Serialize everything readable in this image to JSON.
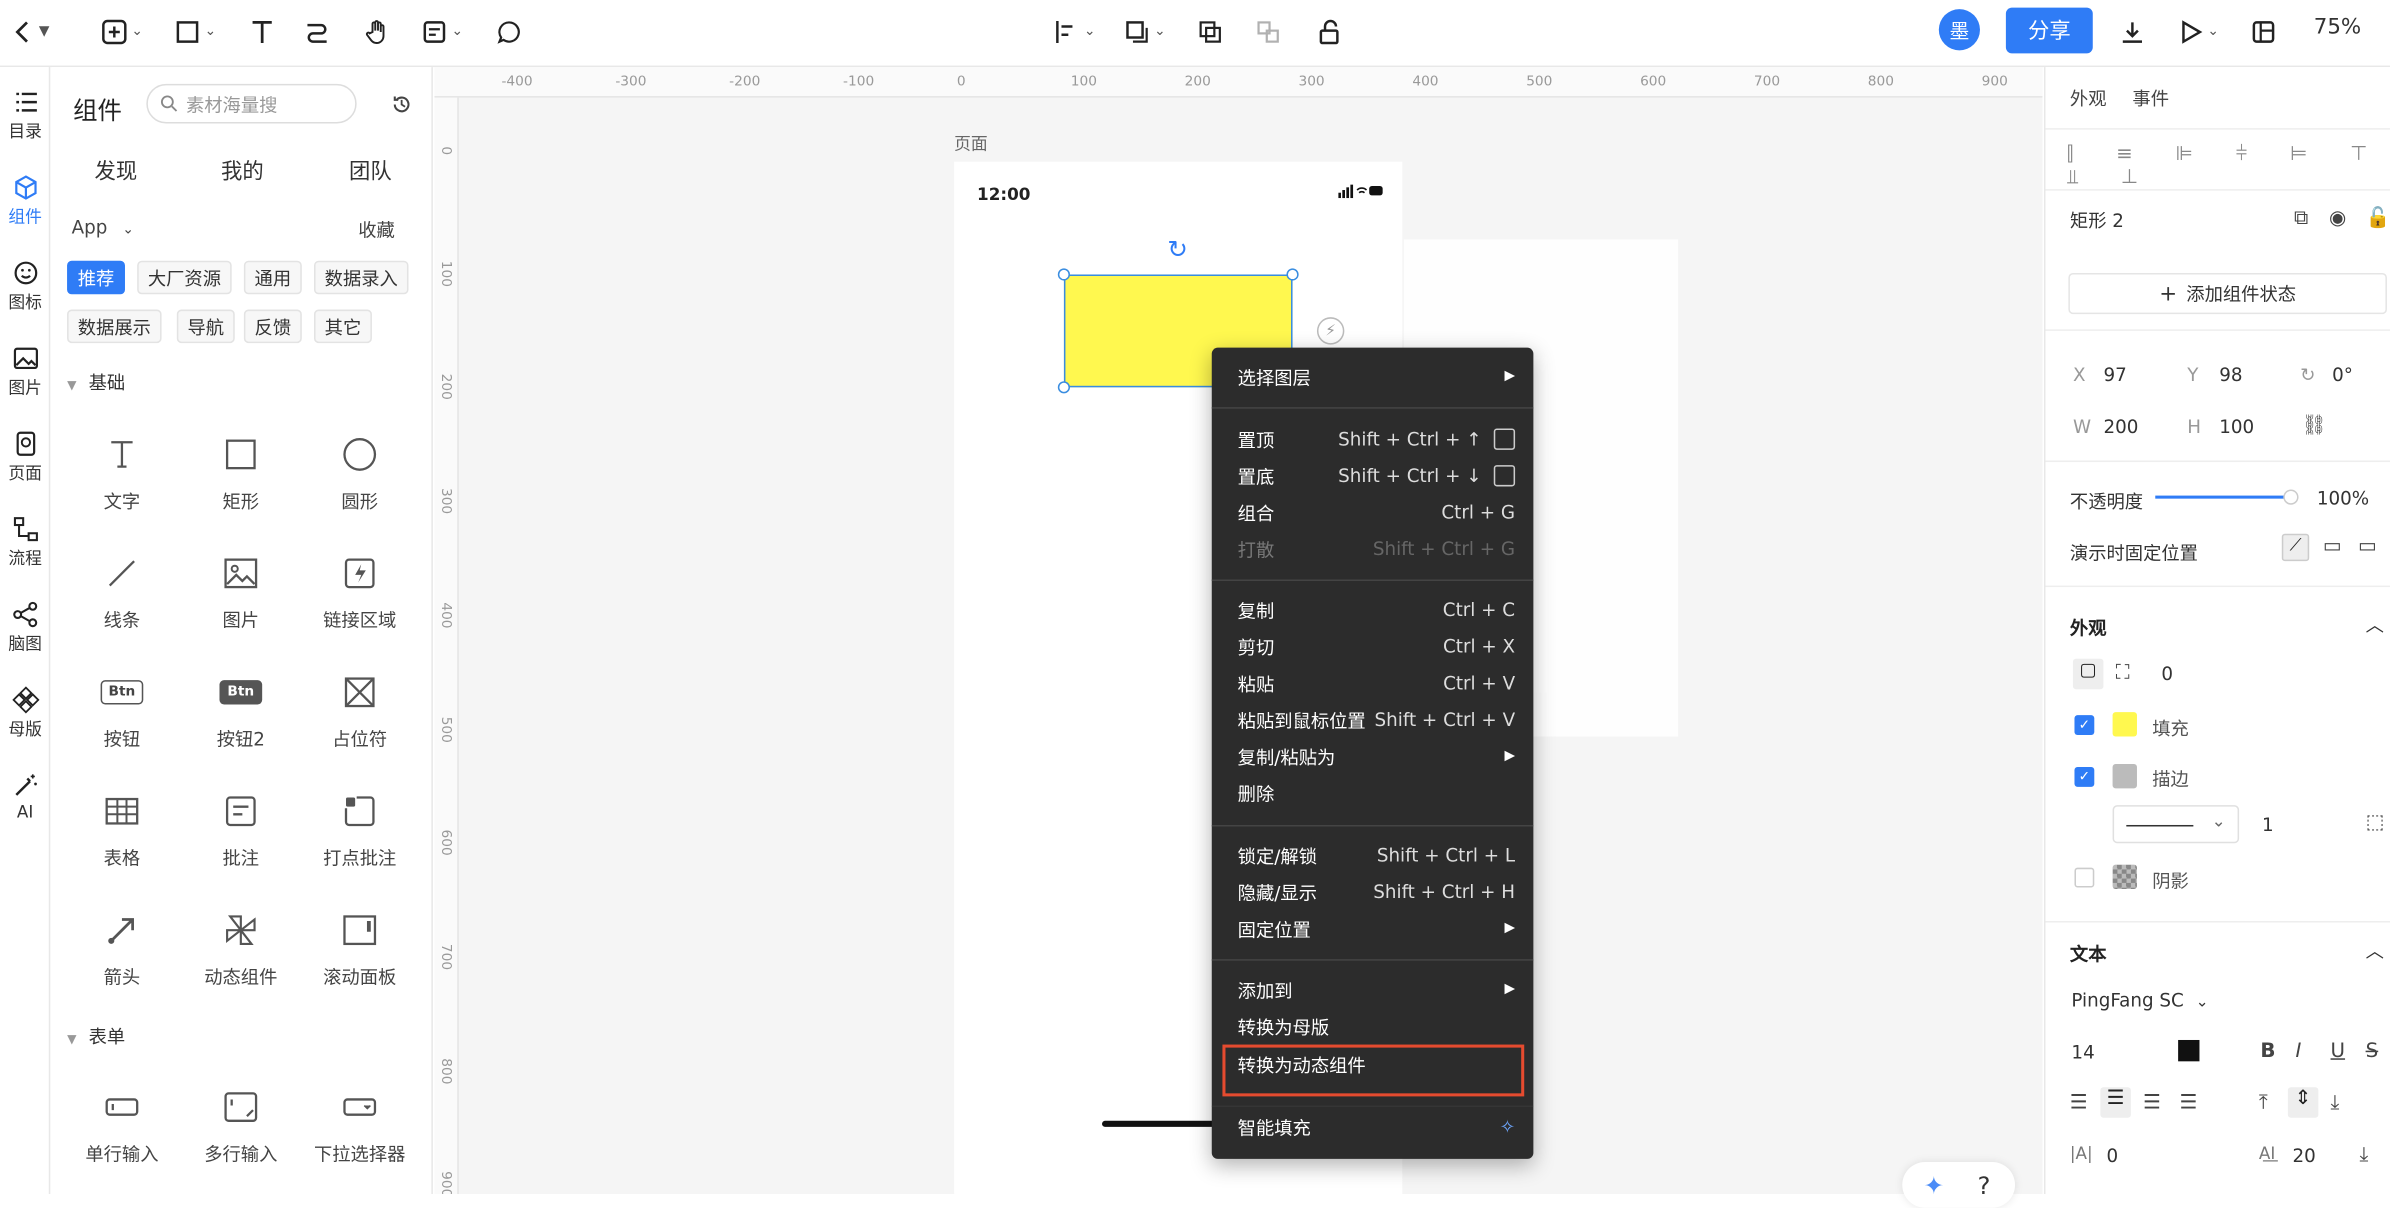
{
  "toolbar": {
    "avatar": "墨",
    "share_label": "分享",
    "zoom": "75%"
  },
  "rail": [
    {
      "label": "目录",
      "icon": "list-icon"
    },
    {
      "label": "组件",
      "icon": "cube-icon"
    },
    {
      "label": "图标",
      "icon": "smile-icon"
    },
    {
      "label": "图片",
      "icon": "image-icon"
    },
    {
      "label": "页面",
      "icon": "page-icon"
    },
    {
      "label": "流程",
      "icon": "flow-icon"
    },
    {
      "label": "脑图",
      "icon": "mindmap-icon"
    },
    {
      "label": "母版",
      "icon": "master-icon"
    },
    {
      "label": "AI",
      "icon": "magic-wand-icon"
    }
  ],
  "panel": {
    "title": "组件",
    "search_placeholder": "素材海量搜",
    "tabs": [
      "发现",
      "我的",
      "团队"
    ],
    "app_select": "App",
    "favorites": "收藏",
    "chips_row1": [
      "推荐",
      "大厂资源",
      "通用",
      "数据录入"
    ],
    "chips_row2": [
      "数据展示",
      "导航",
      "反馈",
      "其它"
    ],
    "section_basic": "基础",
    "components": [
      {
        "label": "文字",
        "icon": "text-icon"
      },
      {
        "label": "矩形",
        "icon": "rectangle-icon"
      },
      {
        "label": "圆形",
        "icon": "circle-icon"
      },
      {
        "label": "线条",
        "icon": "line-icon"
      },
      {
        "label": "图片",
        "icon": "image-icon"
      },
      {
        "label": "链接区域",
        "icon": "link-area-icon"
      },
      {
        "label": "按钮",
        "icon": "button-icon",
        "glyph": "Btn"
      },
      {
        "label": "按钮2",
        "icon": "button2-icon",
        "glyph": "Btn"
      },
      {
        "label": "占位符",
        "icon": "placeholder-icon"
      },
      {
        "label": "表格",
        "icon": "table-icon"
      },
      {
        "label": "批注",
        "icon": "note-icon"
      },
      {
        "label": "打点批注",
        "icon": "dot-note-icon"
      },
      {
        "label": "箭头",
        "icon": "arrow-icon"
      },
      {
        "label": "动态组件",
        "icon": "dynamic-component-icon"
      },
      {
        "label": "滚动面板",
        "icon": "scroll-panel-icon"
      }
    ],
    "section_form": "表单",
    "form_components": [
      {
        "label": "单行输入",
        "icon": "single-input-icon"
      },
      {
        "label": "多行输入",
        "icon": "multi-input-icon"
      },
      {
        "label": "下拉选择器",
        "icon": "dropdown-icon"
      }
    ]
  },
  "canvas": {
    "ruler_top": [
      "-400",
      "-300",
      "-200",
      "-100",
      "0",
      "100",
      "200",
      "300",
      "400",
      "500",
      "600",
      "700",
      "800",
      "900"
    ],
    "ruler_left": [
      "0",
      "100",
      "200",
      "300",
      "400",
      "500",
      "600",
      "700",
      "800",
      "900"
    ],
    "page_label": "页面",
    "time": "12:00"
  },
  "context_menu": {
    "select_layer": "选择图层",
    "bring_top": {
      "label": "置顶",
      "shortcut": "Shift + Ctrl + ↑"
    },
    "send_bottom": {
      "label": "置底",
      "shortcut": "Shift + Ctrl + ↓"
    },
    "group": {
      "label": "组合",
      "shortcut": "Ctrl + G"
    },
    "ungroup": {
      "label": "打散",
      "shortcut": "Shift + Ctrl + G"
    },
    "copy": {
      "label": "复制",
      "shortcut": "Ctrl + C"
    },
    "cut": {
      "label": "剪切",
      "shortcut": "Ctrl + X"
    },
    "paste": {
      "label": "粘贴",
      "shortcut": "Ctrl + V"
    },
    "paste_at_mouse": {
      "label": "粘贴到鼠标位置",
      "shortcut": "Shift + Ctrl + V"
    },
    "copy_paste_as": "复制/粘贴为",
    "delete": "删除",
    "lock": {
      "label": "锁定/解锁",
      "shortcut": "Shift + Ctrl + L"
    },
    "hide": {
      "label": "隐藏/显示",
      "shortcut": "Shift + Ctrl + H"
    },
    "fixed_position": "固定位置",
    "add_to": "添加到",
    "to_master": "转换为母版",
    "to_dynamic": "转换为动态组件",
    "smart_fill": "智能填充"
  },
  "right": {
    "tab_appearance": "外观",
    "tab_events": "事件",
    "layer_name": "矩形 2",
    "add_state": "添加组件状态",
    "x_label": "X",
    "x": "97",
    "y_label": "Y",
    "y": "98",
    "rotation": "0°",
    "w_label": "W",
    "w": "200",
    "h_label": "H",
    "h": "100",
    "opacity_label": "不透明度",
    "opacity": "100%",
    "opacity_value": 1.0,
    "fixed_label": "演示时固定位置",
    "appearance_title": "外观",
    "radius": "0",
    "fill_label": "填充",
    "fill_checked": true,
    "fill_color": "#fff84f",
    "stroke_label": "描边",
    "stroke_checked": true,
    "stroke_color": "#bbbbbb",
    "stroke_width": "1",
    "shadow_label": "阴影",
    "shadow_checked": false,
    "text_title": "文本",
    "font": "PingFang SC",
    "font_size": "14",
    "text_color": "#111111",
    "letter_spacing": "0",
    "line_height": "20"
  }
}
